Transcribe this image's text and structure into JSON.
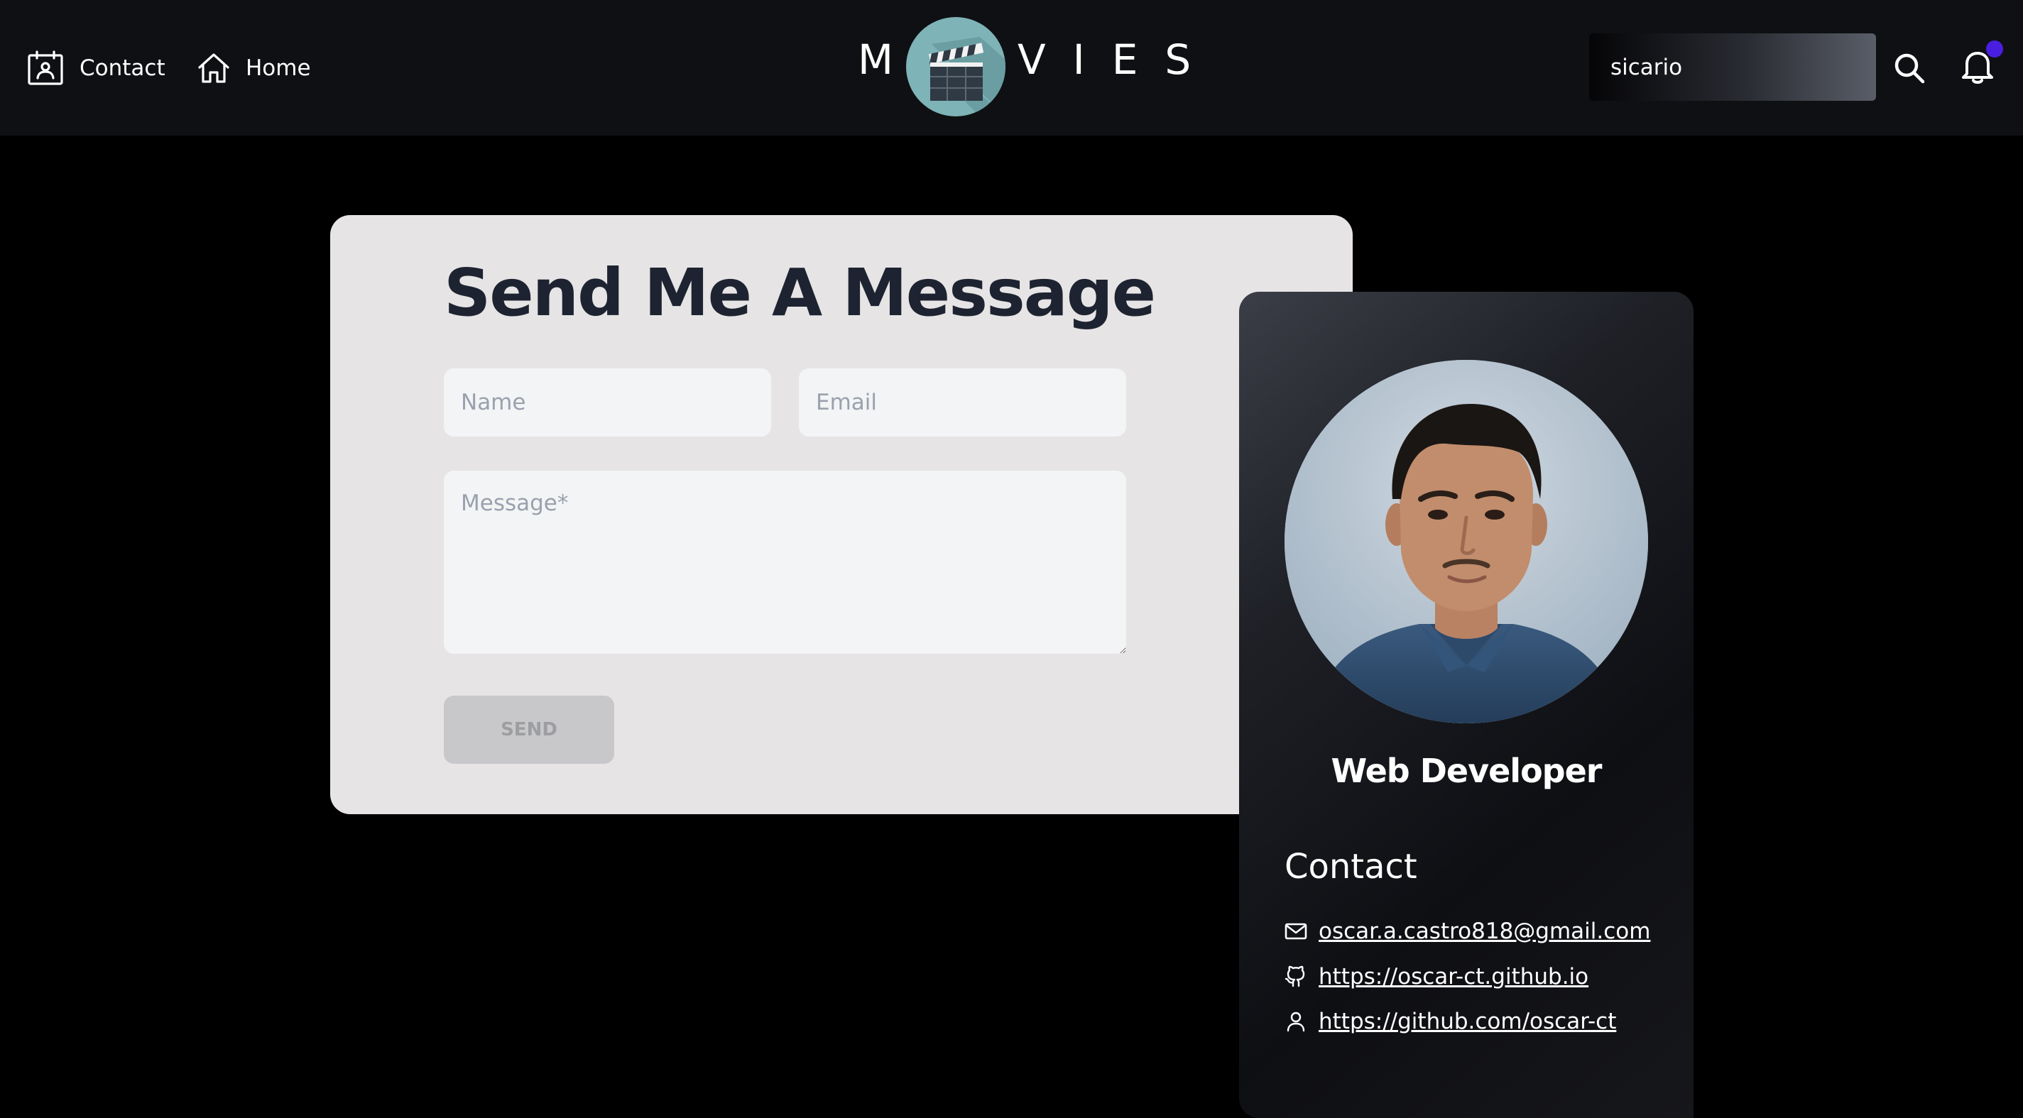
{
  "nav": {
    "contact_label": "Contact",
    "home_label": "Home"
  },
  "brand": {
    "first_letter": "M",
    "rest_letters": "VIES",
    "logo_icon": "film-clapperboard-icon",
    "logo_bg": "#7eb3b7"
  },
  "search": {
    "value": "sicario",
    "icon": "search-icon"
  },
  "notifications": {
    "icon": "bell-icon",
    "dot_color": "#4a1ee0"
  },
  "form": {
    "title": "Send Me A Message",
    "name_placeholder": "Name",
    "email_placeholder": "Email",
    "message_placeholder": "Message*",
    "send_label": "SEND"
  },
  "profile": {
    "role": "Web Developer",
    "contact_heading": "Contact",
    "email": "oscar.a.castro818@gmail.com",
    "website": "https://oscar-ct.github.io",
    "github": "https://github.com/oscar-ct"
  },
  "colors": {
    "page_bg": "#000000",
    "header_bg": "#0f1013",
    "card_bg": "#e6e4e5",
    "title_color": "#1d2330",
    "input_bg": "#f3f4f6",
    "send_bg": "#c8c8ca"
  }
}
